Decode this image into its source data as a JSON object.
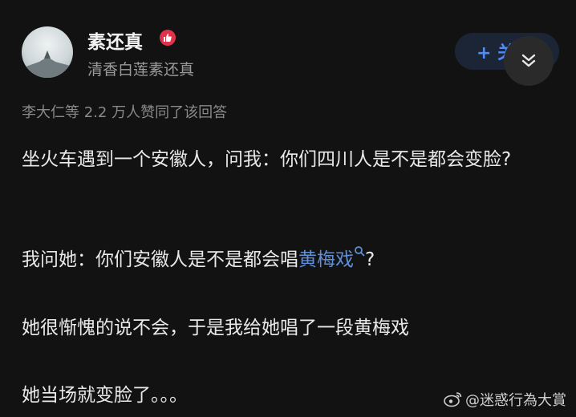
{
  "author": {
    "name": "素还真",
    "bio": "清香白莲素还真"
  },
  "follow_label": "+ 关",
  "likes_text": "李大仁等 2.2 万人赞同了该回答",
  "content": {
    "p1": "坐火车遇到一个安徽人，问我：你们四川人是不是都会变脸?",
    "p2_before": "我问她：你们安徽人是不是都会唱",
    "p2_link": "黄梅戏",
    "p2_after": "?",
    "p3": "她很惭愧的说不会，于是我给她唱了一段黄梅戏",
    "p4": "她当场就变脸了。。。"
  },
  "watermark": "@迷惑行為大賞",
  "colors": {
    "background": "#121212",
    "link": "#5f8fd6",
    "follow": "#4f8df5",
    "badge": "#e0334b"
  }
}
